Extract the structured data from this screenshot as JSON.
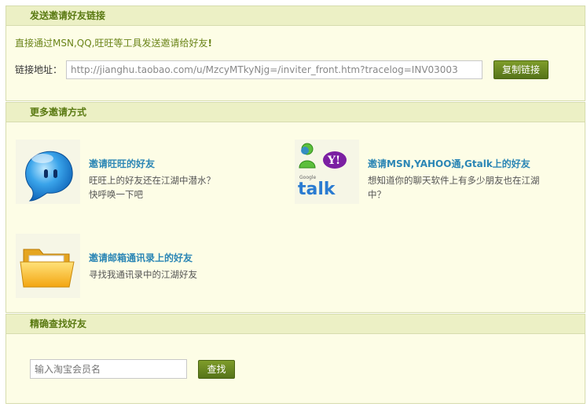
{
  "section1": {
    "title": "发送邀请好友链接",
    "intro": "直接通过MSN,QQ,旺旺等工具发送邀请给好友",
    "intro_mark": "!",
    "link_label": "链接地址：",
    "link_value": "http://jianghu.taobao.com/u/MzcyMTkyNjg=/inviter_front.htm?tracelog=INV03003",
    "copy_button": "复制链接"
  },
  "section2": {
    "title": "更多邀请方式",
    "cards": [
      {
        "title": "邀请旺旺的好友",
        "desc_line1": "旺旺上的好友还在江湖中潜水？",
        "desc_line2": "快呼唤一下吧"
      },
      {
        "title": "邀请MSN,YAHOO通,Gtalk上的好友",
        "desc_line1": "想知道你的聊天软件上有多少朋友也在江湖",
        "desc_line2": "中？",
        "yahoo_text": "Y!",
        "google_text": "Google",
        "talk_text": "talk"
      },
      {
        "title": "邀请邮箱通讯录上的好友",
        "desc_line1": "寻找我通讯录中的江湖好友",
        "desc_line2": ""
      }
    ]
  },
  "section3": {
    "title": "精确查找好友",
    "search_placeholder": "输入淘宝会员名",
    "search_button": "查找"
  }
}
